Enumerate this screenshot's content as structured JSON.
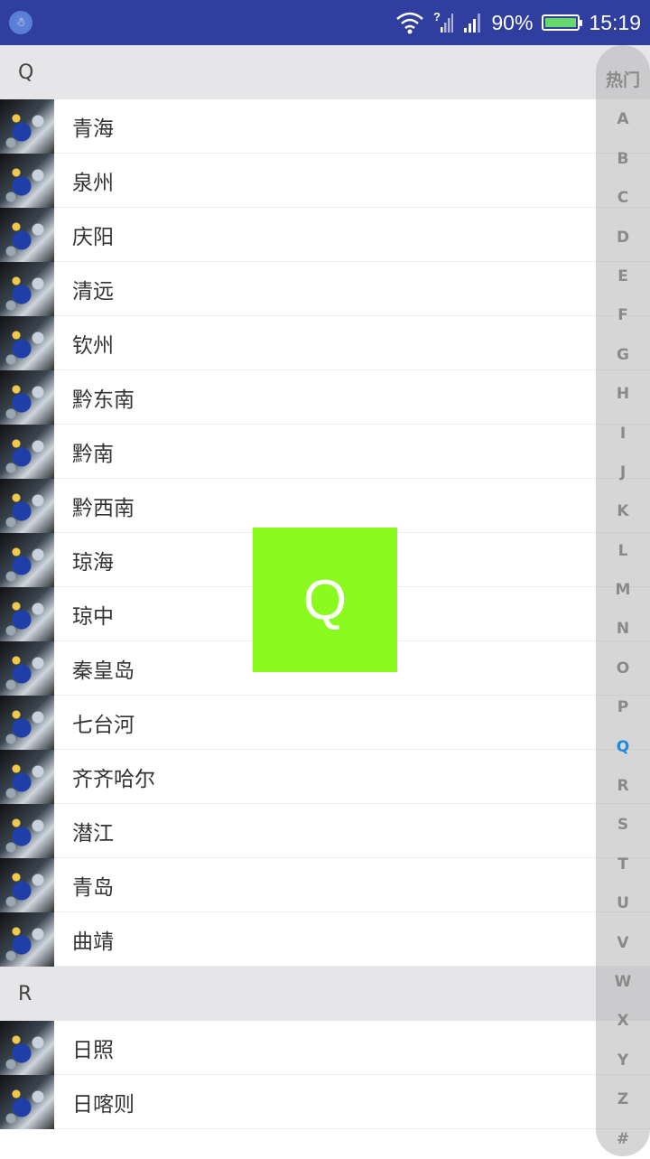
{
  "status_bar": {
    "battery_percent": "90%",
    "time": "15:19",
    "app_icon": "android-icon",
    "wifi_icon": "wifi-icon",
    "signal_icons": [
      "signal-unknown-icon",
      "signal-icon"
    ],
    "signal_question": "?"
  },
  "sections": [
    {
      "header": "Q",
      "items": [
        "青海",
        "泉州",
        "庆阳",
        "清远",
        "钦州",
        "黔东南",
        "黔南",
        "黔西南",
        "琼海",
        "琼中",
        "秦皇岛",
        "七台河",
        "齐齐哈尔",
        "潜江",
        "青岛",
        "曲靖"
      ]
    },
    {
      "header": "R",
      "items": [
        "日照",
        "日喀则"
      ]
    }
  ],
  "index_bar": {
    "letters": [
      "热门",
      "A",
      "B",
      "C",
      "D",
      "E",
      "F",
      "G",
      "H",
      "I",
      "J",
      "K",
      "L",
      "M",
      "N",
      "O",
      "P",
      "Q",
      "R",
      "S",
      "T",
      "U",
      "V",
      "W",
      "X",
      "Y",
      "Z",
      "#"
    ],
    "active": "Q",
    "active_color": "#1e88e5"
  },
  "overlay": {
    "letter": "Q",
    "color": "#8afa1f"
  }
}
